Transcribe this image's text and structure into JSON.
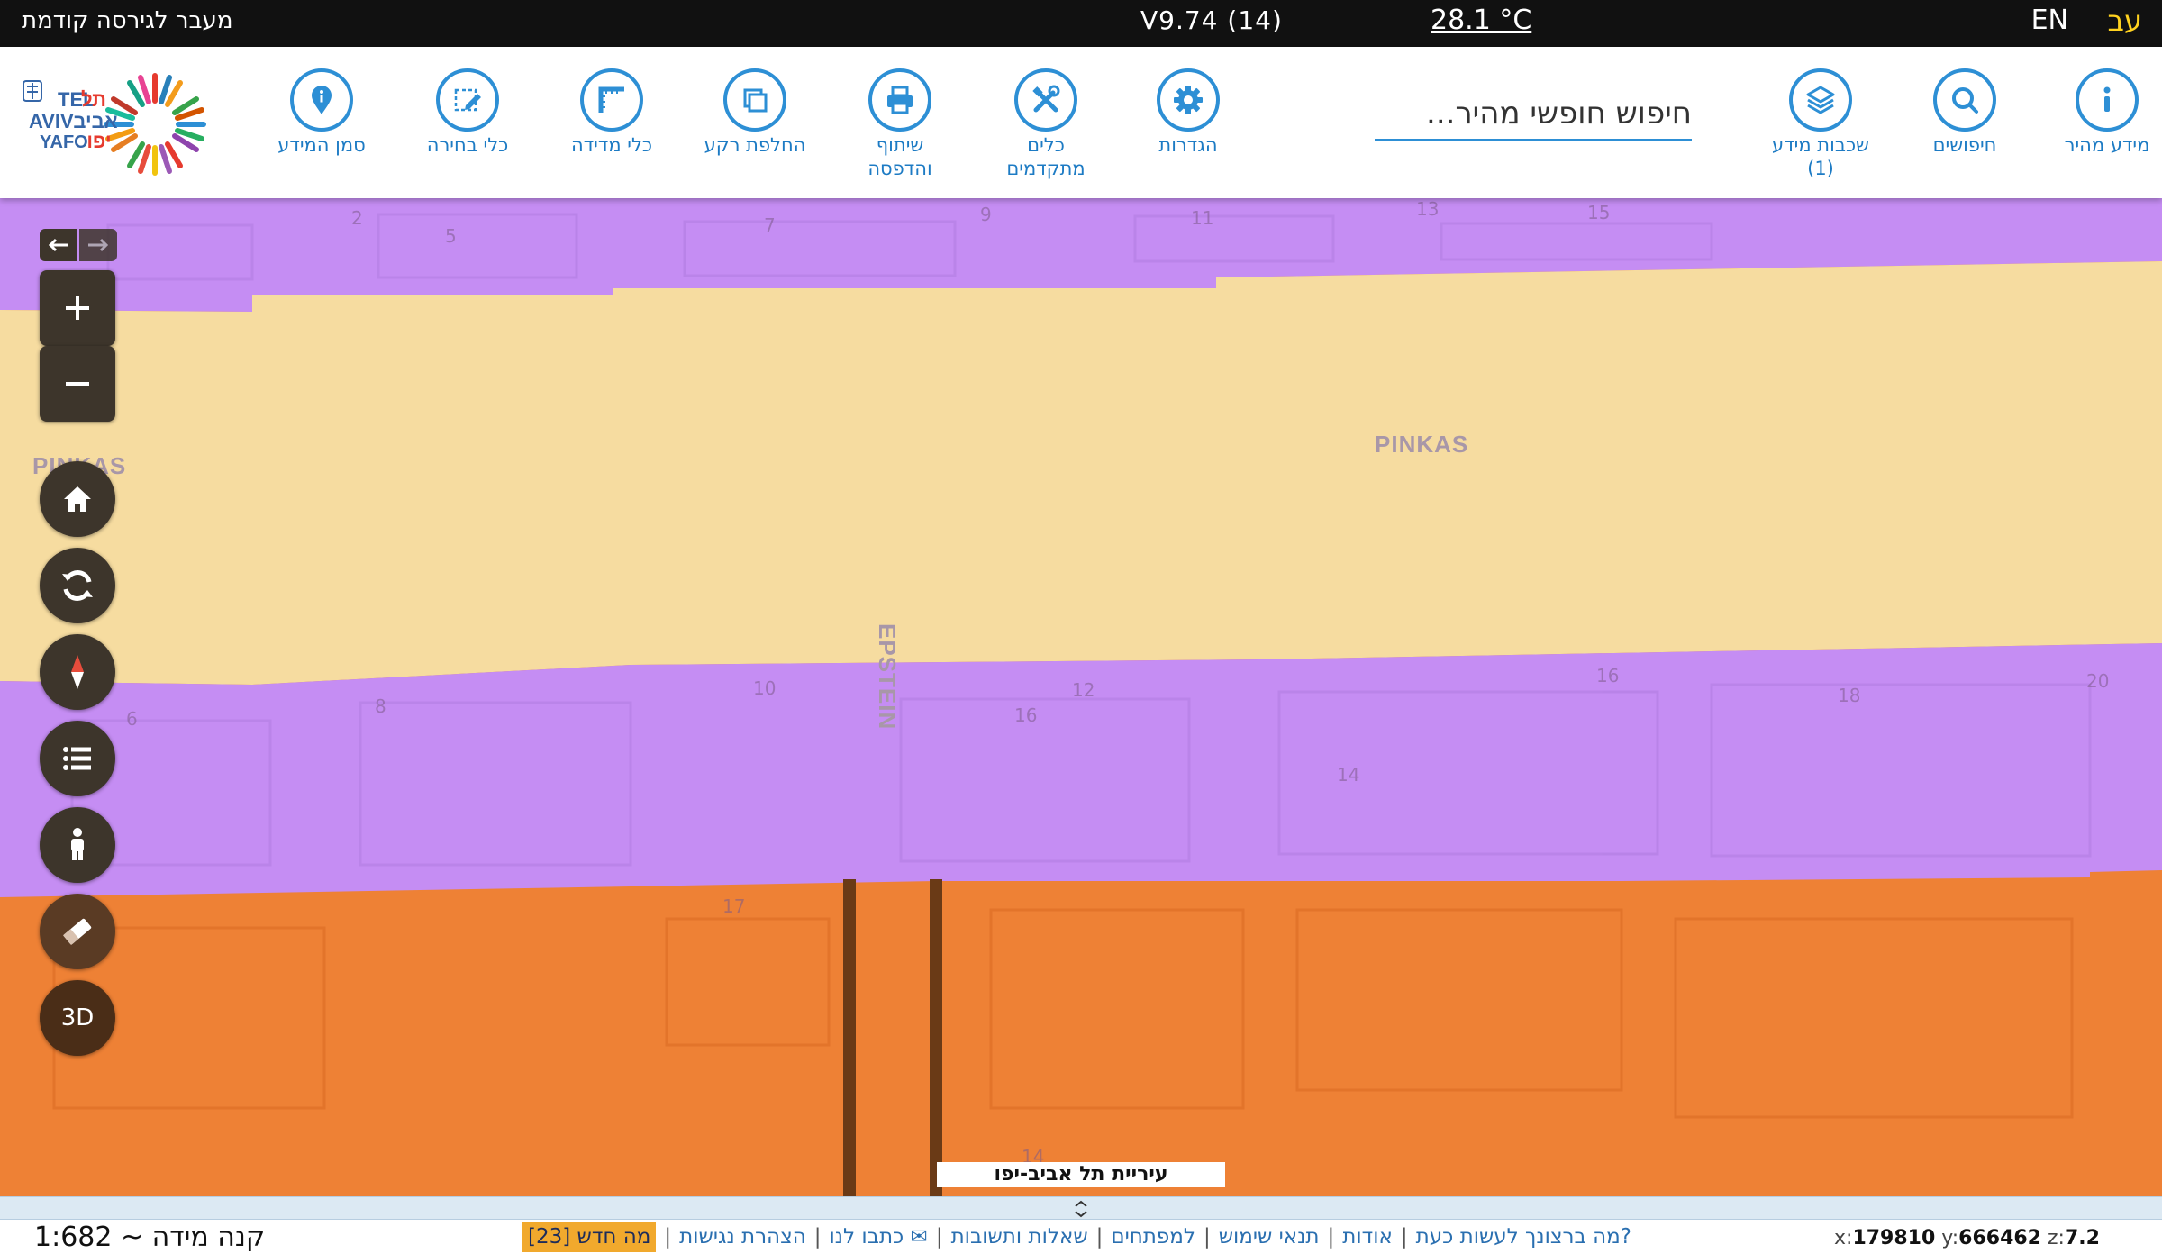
{
  "topbar": {
    "lang_he": "עב",
    "lang_en": "EN",
    "temperature": "28.1 °C",
    "version": "V9.74 (14)",
    "prev_version": "מעבר לגירסה קודמת"
  },
  "toolbar": {
    "quick_info": "מידע מהיר",
    "searches": "חיפושים",
    "layers": "שכבות מידע",
    "layers_count": "(1)",
    "search_placeholder": "חיפוש חופשי מהיר...",
    "settings": "הגדרות",
    "advanced_tools_1": "כלים",
    "advanced_tools_2": "מתקדמים",
    "share_print_1": "שיתוף",
    "share_print_2": "והדפסה",
    "basemap": "החלפת רקע",
    "measure": "כלי מדידה",
    "select": "כלי בחירה",
    "info_marker": "סמן המידע"
  },
  "map": {
    "streets": [
      "PINKAS",
      "PINKAS",
      "EPSTEIN"
    ],
    "house_numbers": [
      "2",
      "5",
      "7",
      "9",
      "11",
      "13",
      "15",
      "10",
      "12",
      "16",
      "16",
      "18",
      "20",
      "6",
      "8",
      "14",
      "17",
      "14"
    ],
    "credit": "עיריית תל אביב-יפו",
    "colors": {
      "top_band": "#c58df3",
      "yellow_band": "#f6dca0",
      "mid_band": "#c58df3",
      "orange_band": "#ee8135"
    }
  },
  "controls": {
    "zoom_in": "+",
    "zoom_out": "−",
    "three_d": "3D"
  },
  "footer": {
    "scale": "קנה מידה ~ 1:682",
    "links": [
      "מה ברצונך לעשות כעת?",
      "אודות",
      "תנאי שימוש",
      "למפתחים",
      "שאלות ותשובות",
      "כתבו לנו ✉",
      "הצהרת נגישות"
    ],
    "whats_new": "מה חדש [23]",
    "coords": {
      "x_label": "x:",
      "x": "179810",
      "y_label": "y:",
      "y": "666462",
      "z_label": "z:",
      "z": "7.2"
    }
  }
}
